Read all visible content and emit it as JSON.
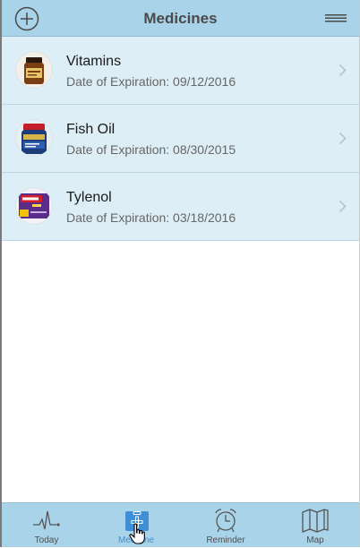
{
  "header": {
    "title": "Medicines",
    "add_icon": "plus-circle-icon",
    "menu_icon": "hamburger-menu-icon"
  },
  "medicines": [
    {
      "name": "Vitamins",
      "expiration": "Date of Expiration: 09/12/2016",
      "thumbnail": "vitamin-bottle"
    },
    {
      "name": "Fish Oil",
      "expiration": "Date of Expiration: 08/30/2015",
      "thumbnail": "fish-oil-bottle"
    },
    {
      "name": "Tylenol",
      "expiration": "Date of Expiration: 03/18/2016",
      "thumbnail": "tylenol-box"
    }
  ],
  "tabs": [
    {
      "label": "Today",
      "icon": "heartbeat-icon"
    },
    {
      "label": "Medicine",
      "icon": "medical-kit-icon",
      "active": true
    },
    {
      "label": "Reminder",
      "icon": "alarm-clock-icon"
    },
    {
      "label": "Map",
      "icon": "map-icon"
    }
  ],
  "colors": {
    "bar": "#a9d3e8",
    "row": "#ddeef7",
    "accent": "#3e8fd6"
  }
}
